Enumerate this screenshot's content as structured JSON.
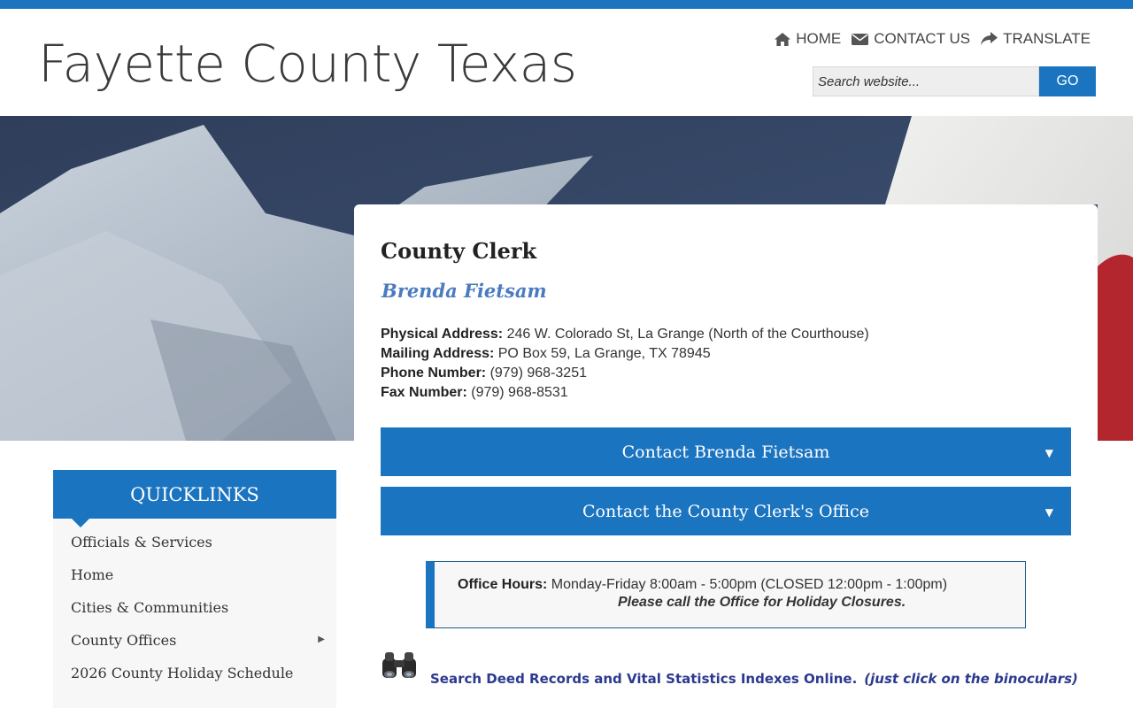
{
  "header": {
    "site_title": "Fayette County Texas",
    "nav": [
      {
        "icon": "home-icon",
        "label": "HOME"
      },
      {
        "icon": "envelope-icon",
        "label": "CONTACT US"
      },
      {
        "icon": "share-arrow-icon",
        "label": "TRANSLATE"
      }
    ],
    "search": {
      "placeholder": "Search website...",
      "button_label": "GO"
    }
  },
  "hero": {
    "image": "texas-flag-photo"
  },
  "main": {
    "title": "County Clerk",
    "official_name": "Brenda Fietsam",
    "info": [
      {
        "label": "Physical Address:",
        "value": " 246 W. Colorado St, La Grange (North of the Courthouse)"
      },
      {
        "label": "Mailing Address:",
        "value": " PO Box 59, La Grange, TX  78945"
      },
      {
        "label": "Phone Number:",
        "value": " (979) 968-3251"
      },
      {
        "label": "Fax Number:",
        "value": " (979) 968-8531"
      }
    ],
    "accordions": [
      {
        "label": "Contact Brenda Fietsam",
        "caret": "▼"
      },
      {
        "label": "Contact the County Clerk's Office",
        "caret": "▼"
      }
    ],
    "hours": {
      "label": "Office Hours:",
      "value": " Monday-Friday 8:00am - 5:00pm (CLOSED 12:00pm - 1:00pm)",
      "note": "Please call the Office for Holiday Closures."
    },
    "deed_search": {
      "text": "Search Deed Records and Vital Statistics Indexes Online.",
      "hint": "(just click on the binoculars)"
    }
  },
  "quicklinks": {
    "title": "QUICKLINKS",
    "items": [
      {
        "label": "Officials & Services",
        "has_submenu": false
      },
      {
        "label": "Home",
        "has_submenu": false
      },
      {
        "label": "Cities & Communities",
        "has_submenu": false
      },
      {
        "label": "County Offices",
        "has_submenu": true
      },
      {
        "label": "2026 County Holiday Schedule",
        "has_submenu": false
      }
    ],
    "submenu_arrow": "▶"
  },
  "colors": {
    "accent": "#1b74c0",
    "link": "#2b3a8f",
    "official_name": "#4b7bbf",
    "flag_red": "#b91c24"
  }
}
